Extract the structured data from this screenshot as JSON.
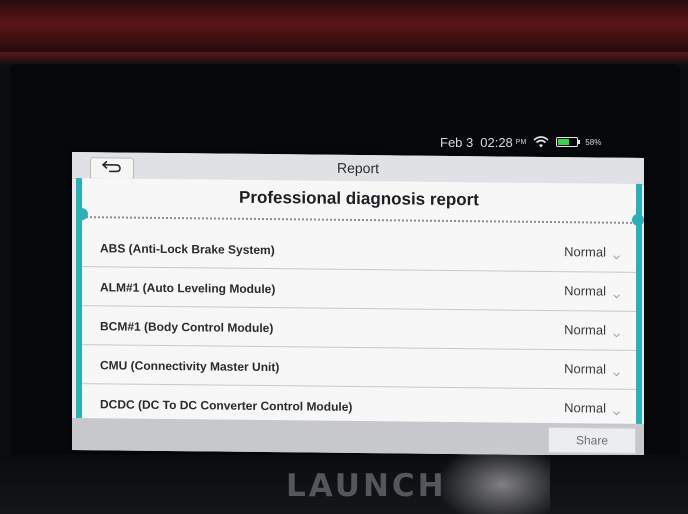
{
  "device": {
    "brand": "LAUNCH"
  },
  "status_bar": {
    "date": "Feb 3",
    "time": "02:28",
    "ampm": "PM",
    "battery_percent": "58%",
    "battery_level": 0.58,
    "wifi_icon": "wifi-icon",
    "battery_icon": "battery-icon"
  },
  "app": {
    "title": "Report",
    "back_icon": "back-arrow-icon",
    "heading": "Professional diagnosis report",
    "accent_color": "#2bb0b8",
    "rows": [
      {
        "label": "ABS (Anti-Lock Brake System)",
        "status": "Normal"
      },
      {
        "label": "ALM#1 (Auto Leveling Module)",
        "status": "Normal"
      },
      {
        "label": "BCM#1 (Body Control Module)",
        "status": "Normal"
      },
      {
        "label": "CMU (Connectivity Master Unit)",
        "status": "Normal"
      },
      {
        "label": "DCDC (DC To DC Converter Control Module)",
        "status": "Normal"
      }
    ],
    "share_label": "Share"
  }
}
